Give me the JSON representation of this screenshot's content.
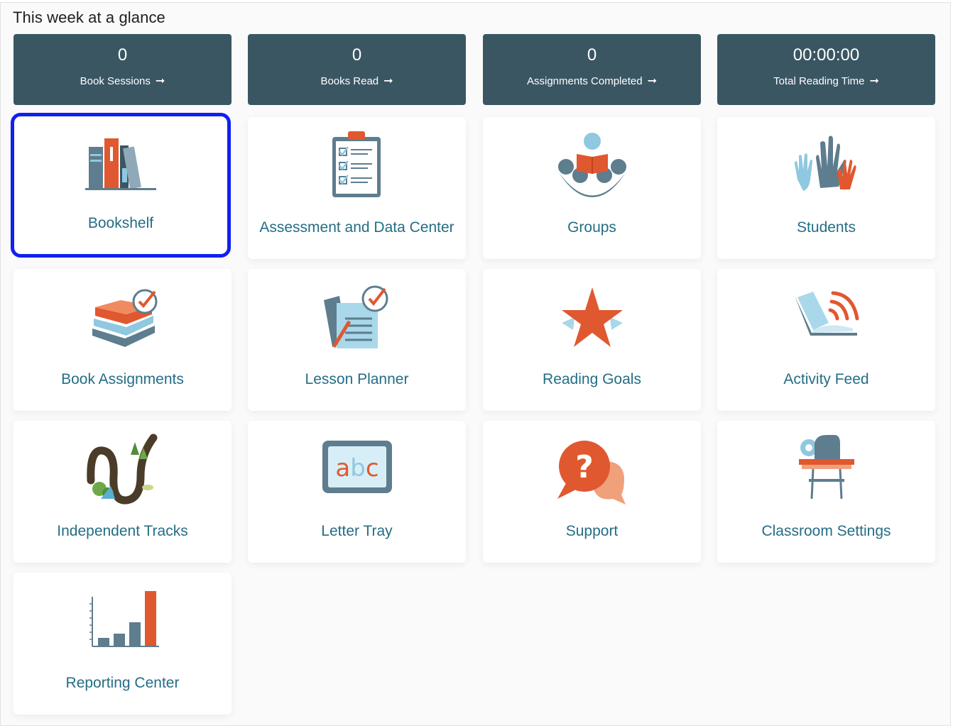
{
  "heading": "This week at a glance",
  "stats": [
    {
      "value": "0",
      "label": "Book Sessions"
    },
    {
      "value": "0",
      "label": "Books Read"
    },
    {
      "value": "0",
      "label": "Assignments Completed"
    },
    {
      "value": "00:00:00",
      "label": "Total Reading Time"
    }
  ],
  "stat_arrow_icon": "arrow-right-icon",
  "tiles": [
    {
      "label": "Bookshelf",
      "icon": "bookshelf-icon",
      "selected": true
    },
    {
      "label": "Assessment and Data Center",
      "icon": "clipboard-checklist-icon"
    },
    {
      "label": "Groups",
      "icon": "reading-group-icon"
    },
    {
      "label": "Students",
      "icon": "raised-hands-icon"
    },
    {
      "label": "Book Assignments",
      "icon": "book-stack-check-icon"
    },
    {
      "label": "Lesson Planner",
      "icon": "lesson-plan-check-icon"
    },
    {
      "label": "Reading Goals",
      "icon": "star-icon"
    },
    {
      "label": "Activity Feed",
      "icon": "open-book-broadcast-icon"
    },
    {
      "label": "Independent Tracks",
      "icon": "winding-track-icon"
    },
    {
      "label": "Letter Tray",
      "icon": "abc-board-icon"
    },
    {
      "label": "Support",
      "icon": "question-chat-icon"
    },
    {
      "label": "Classroom Settings",
      "icon": "desk-gear-icon"
    },
    {
      "label": "Reporting Center",
      "icon": "bar-chart-icon"
    }
  ],
  "colors": {
    "stat_background": "#3a5662",
    "tile_label": "#256d85",
    "selected_border": "#1020f0",
    "accent_orange": "#e0582f",
    "slate": "#5e7d8e",
    "light_blue": "#8fc8e0"
  }
}
